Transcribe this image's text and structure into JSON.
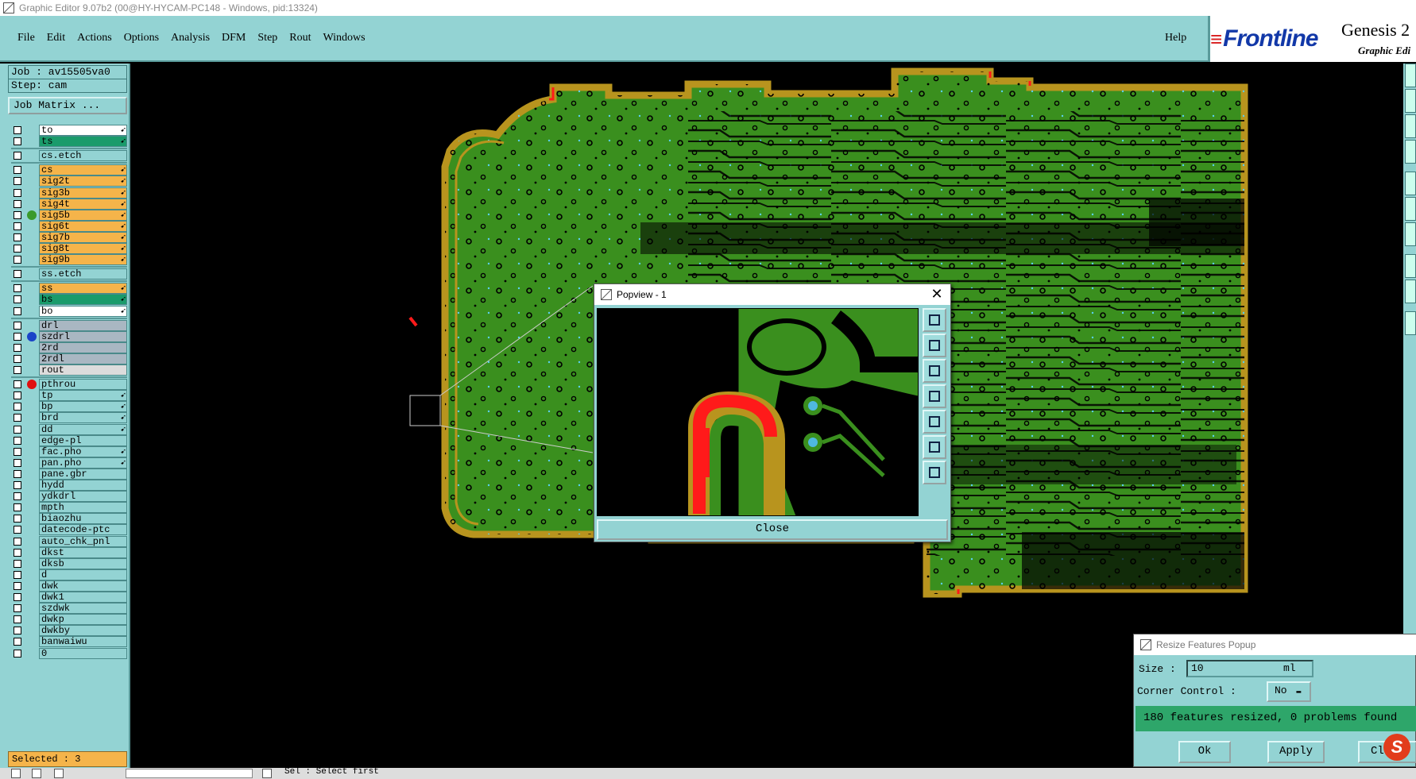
{
  "window": {
    "title": "Graphic Editor 9.07b2 (00@HY-HYCAM-PC148 - Windows, pid:13324)"
  },
  "menu": {
    "items": [
      "File",
      "Edit",
      "Actions",
      "Options",
      "Analysis",
      "DFM",
      "Step",
      "Rout",
      "Windows"
    ],
    "help": "Help"
  },
  "brand": {
    "logo": "Frontline",
    "title": "Genesis 2",
    "subtitle": "Graphic Edi"
  },
  "left": {
    "job": "Job : av15505va0",
    "step": "Step: cam",
    "job_matrix": "Job Matrix ...",
    "selected": "Selected : 3"
  },
  "layers": [
    {
      "name": "to",
      "color": "#ffffff",
      "arrow": true
    },
    {
      "name": "ts",
      "color": "#1a9b6b",
      "arrow": true
    },
    {
      "name": "cs.etch",
      "color": "#93d3d3",
      "arrow": false
    },
    {
      "name": "cs",
      "color": "#f5b44a",
      "arrow": true
    },
    {
      "name": "sig2t",
      "color": "#f5b44a",
      "arrow": true
    },
    {
      "name": "sig3b",
      "color": "#f5b44a",
      "arrow": true
    },
    {
      "name": "sig4t",
      "color": "#f5b44a",
      "arrow": true
    },
    {
      "name": "sig5b",
      "color": "#f5b44a",
      "arrow": true,
      "indicator": "#3a9a2a"
    },
    {
      "name": "sig6t",
      "color": "#f5b44a",
      "arrow": true
    },
    {
      "name": "sig7b",
      "color": "#f5b44a",
      "arrow": true
    },
    {
      "name": "sig8t",
      "color": "#f5b44a",
      "arrow": true
    },
    {
      "name": "sig9b",
      "color": "#f5b44a",
      "arrow": true
    },
    {
      "name": "ss.etch",
      "color": "#93d3d3",
      "arrow": false
    },
    {
      "name": "ss",
      "color": "#f5b44a",
      "arrow": true
    },
    {
      "name": "bs",
      "color": "#1a9b6b",
      "arrow": true
    },
    {
      "name": "bo",
      "color": "#ffffff",
      "arrow": true
    },
    {
      "name": "drl",
      "color": "#a9b7c2",
      "arrow": false
    },
    {
      "name": "szdrl",
      "color": "#a9b7c2",
      "arrow": false,
      "indicator": "#1a44c8"
    },
    {
      "name": "2rd",
      "color": "#a9b7c2",
      "arrow": false
    },
    {
      "name": "2rdl",
      "color": "#a9b7c2",
      "arrow": false
    },
    {
      "name": "rout",
      "color": "#dcdcdc",
      "arrow": false
    },
    {
      "name": "pthrou",
      "color": "#93d3d3",
      "arrow": false,
      "indicator": "#e01010"
    },
    {
      "name": "tp",
      "color": "#93d3d3",
      "arrow": true
    },
    {
      "name": "bp",
      "color": "#93d3d3",
      "arrow": true
    },
    {
      "name": "brd",
      "color": "#93d3d3",
      "arrow": true
    },
    {
      "name": "dd",
      "color": "#93d3d3",
      "arrow": true
    },
    {
      "name": "edge-pl",
      "color": "#93d3d3",
      "arrow": false
    },
    {
      "name": "fac.pho",
      "color": "#93d3d3",
      "arrow": true
    },
    {
      "name": "pan.pho",
      "color": "#93d3d3",
      "arrow": true
    },
    {
      "name": "pane.gbr",
      "color": "#93d3d3",
      "arrow": false
    },
    {
      "name": "hydd",
      "color": "#93d3d3",
      "arrow": false
    },
    {
      "name": "ydkdrl",
      "color": "#93d3d3",
      "arrow": false
    },
    {
      "name": "mpth",
      "color": "#93d3d3",
      "arrow": false
    },
    {
      "name": "biaozhu",
      "color": "#93d3d3",
      "arrow": false
    },
    {
      "name": "datecode-ptc",
      "color": "#93d3d3",
      "arrow": false
    },
    {
      "name": "auto_chk_pnl",
      "color": "#93d3d3",
      "arrow": false
    },
    {
      "name": "dkst",
      "color": "#93d3d3",
      "arrow": false
    },
    {
      "name": "dksb",
      "color": "#93d3d3",
      "arrow": false
    },
    {
      "name": "d",
      "color": "#93d3d3",
      "arrow": false
    },
    {
      "name": "dwk",
      "color": "#93d3d3",
      "arrow": false
    },
    {
      "name": "dwk1",
      "color": "#93d3d3",
      "arrow": false
    },
    {
      "name": "szdwk",
      "color": "#93d3d3",
      "arrow": false
    },
    {
      "name": "dwkp",
      "color": "#93d3d3",
      "arrow": false
    },
    {
      "name": "dwkby",
      "color": "#93d3d3",
      "arrow": false
    },
    {
      "name": "banwaiwu",
      "color": "#93d3d3",
      "arrow": false
    },
    {
      "name": "0",
      "color": "#93d3d3",
      "arrow": false
    }
  ],
  "popview": {
    "title": "Popview - 1",
    "close_label": "Close"
  },
  "resize": {
    "title": "Resize Features Popup",
    "size_label": "Size :",
    "size_value": "10",
    "unit": "ml",
    "corner_label": "Corner Control :",
    "corner_value": "No",
    "message": "180 features resized, 0 problems found",
    "ok": "Ok",
    "apply": "Apply",
    "close": "Cl"
  },
  "status": {
    "message": "Sel : Select first"
  },
  "colors": {
    "panel": "#93d3d3",
    "board": "#3a8f1e",
    "outline": "#b8941e",
    "highlight": "#ff1a1a",
    "pad": "#4fb8e0"
  }
}
